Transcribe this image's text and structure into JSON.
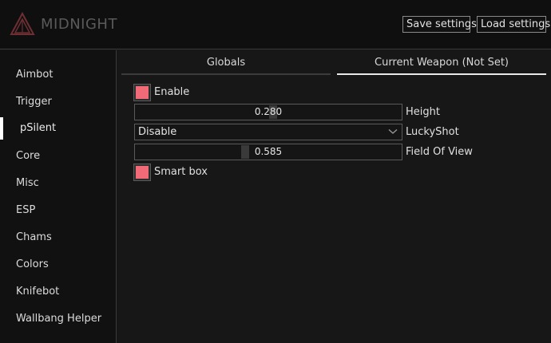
{
  "header": {
    "brand": "MIDNIGHT",
    "save_label": "Save settings",
    "load_label": "Load settings"
  },
  "sidebar": {
    "items": [
      {
        "label": "Aimbot"
      },
      {
        "label": "Trigger"
      },
      {
        "label": "pSilent",
        "active": true
      },
      {
        "label": "Core"
      },
      {
        "label": "Misc"
      },
      {
        "label": "ESP"
      },
      {
        "label": "Chams"
      },
      {
        "label": "Colors"
      },
      {
        "label": "Knifebot"
      },
      {
        "label": "Wallbang Helper"
      }
    ]
  },
  "tabs": [
    {
      "label": "Globals"
    },
    {
      "label": "Current Weapon (Not Set)",
      "active": true
    }
  ],
  "controls": {
    "enable": {
      "label": "Enable",
      "checked": true
    },
    "height": {
      "label": "Height",
      "value": "0.280",
      "fraction": 0.52
    },
    "luckyshot": {
      "label": "LuckyShot",
      "value": "Disable"
    },
    "fov": {
      "label": "Field Of View",
      "value": "0.585",
      "fraction": 0.41
    },
    "smartbox": {
      "label": "Smart box",
      "checked": true
    }
  },
  "colors": {
    "accent": "#f06a78",
    "background": "#171717",
    "header": "#0f0f0f",
    "sidebar": "#111111",
    "active_tab_underline": "#e8e8e8"
  },
  "icons": {
    "logo": "triangle-logo-icon",
    "dropdown": "chevron-down-icon"
  }
}
